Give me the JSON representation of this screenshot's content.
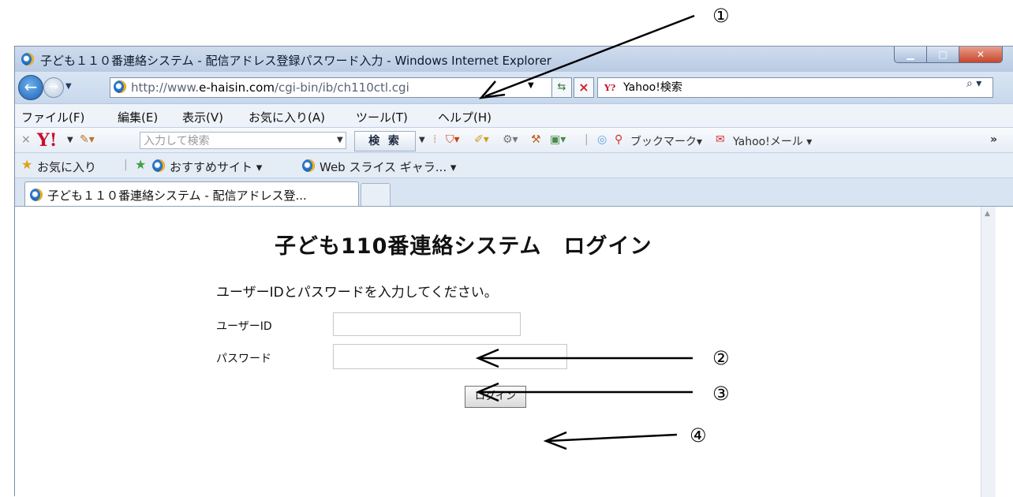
{
  "window": {
    "title": "子ども１１０番連絡システム - 配信アドレス登録パスワード入力 - Windows Internet Explorer"
  },
  "address": {
    "url_prefix": "http://www.",
    "url_domain": "e-haisin.com",
    "url_path": "/cgi-bin/ib/ch110ctl.cgi",
    "search_provider": "Yahoo!検索"
  },
  "menu": [
    "ファイル(F)",
    "編集(E)",
    "表示(V)",
    "お気に入り(A)",
    "ツール(T)",
    "ヘルプ(H)"
  ],
  "yahoo_toolbar": {
    "search_placeholder": "入力して検索",
    "search_button": "検 索",
    "bookmark_label": "ブックマーク",
    "mail_label": "Yahoo!メール"
  },
  "favorites_bar": {
    "favorites": "お気に入り",
    "suggested_sites": "おすすめサイト",
    "web_slice": "Web スライス ギャラ..."
  },
  "tabs": [
    {
      "label": "子ども１１０番連絡システム - 配信アドレス登..."
    }
  ],
  "page": {
    "title": "子ども110番連絡システム　ログイン",
    "instruction": "ユーザーIDとパスワードを入力してください。",
    "user_id_label": "ユーザーID",
    "password_label": "パスワード",
    "login_button": "ログイン",
    "user_id_value": "",
    "password_value": ""
  },
  "callouts": [
    "①",
    "②",
    "③",
    "④"
  ],
  "colors": {
    "chrome": "#dfe9f5",
    "close_button": "#c8462a",
    "text": "#111111"
  }
}
